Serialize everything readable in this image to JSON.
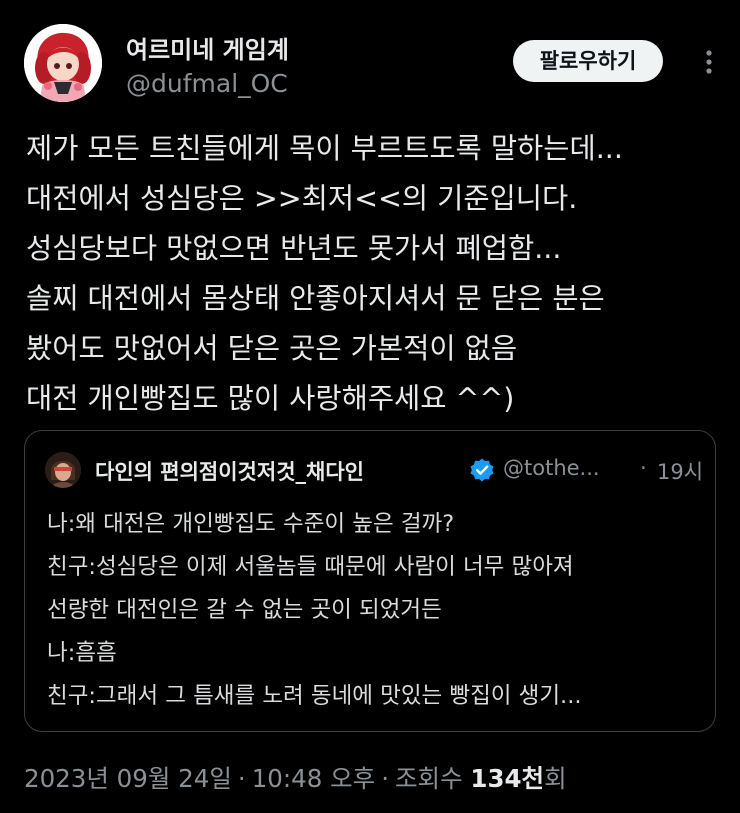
{
  "author": {
    "display_name": "여르미네 게임계",
    "handle": "@dufmal_OC",
    "avatar_icon": "anime-girl-red-hair-avatar"
  },
  "follow_button": {
    "label": "팔로우하기"
  },
  "more_icon": "more-vertical-icon",
  "tweet": {
    "lines": [
      "제가 모든 트친들에게 목이 부르트도록 말하는데...",
      "대전에서 성심당은 >>최저<<의 기준입니다.",
      "성심당보다 맛없으면 반년도 못가서 폐업함...",
      "솔찌 대전에서 몸상태 안좋아지셔서 문 닫은 분은",
      "봤어도 맛없어서 닫은 곳은 가본적이 없음",
      "대전 개인빵집도 많이 사랑해주세요 ^^)"
    ]
  },
  "quote": {
    "display_name": "다인의 편의점이것저것_채다인",
    "handle": "@tothe...",
    "separator": "·",
    "time": "19시",
    "verified_icon": "verified-badge-icon",
    "lines": [
      "나:왜 대전은 개인빵집도 수준이 높은 걸까?",
      "친구:성심당은 이제 서울놈들 때문에 사람이 너무 많아져",
      "선량한 대전인은 갈 수 없는 곳이 되었거든",
      "나:흠흠",
      "친구:그래서 그 틈새를 노려 동네에 맛있는 빵집이 생기..."
    ]
  },
  "meta": {
    "date": "2023년 09월 24일",
    "separator": "·",
    "time": "10:48 오후",
    "views_label": "조회수",
    "views_count": "134천",
    "views_suffix": "회"
  },
  "colors": {
    "background": "#000000",
    "text_primary": "#e7e9ea",
    "text_secondary": "#8b9096",
    "border": "#3a3e42",
    "verified": "#1d9bf0",
    "button_bg": "#eff3f4"
  }
}
